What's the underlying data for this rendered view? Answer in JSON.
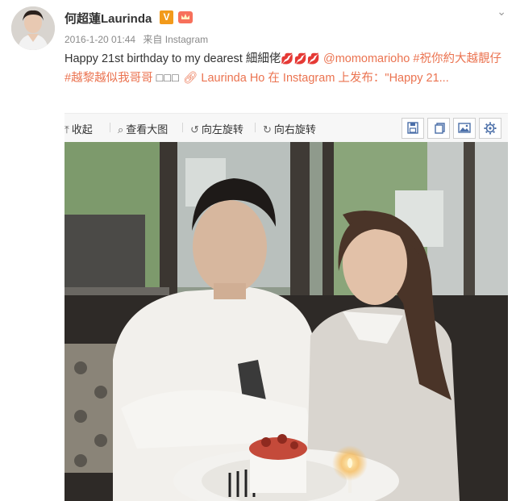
{
  "post": {
    "username": "何超蓮Laurinda",
    "verified_badge": "V",
    "meta": {
      "date": "2016-1-20 01:44",
      "source": "来自 Instagram"
    },
    "content": {
      "text_part1": "Happy 21st birthday to my dearest 細細佬",
      "emoji_glyphs": "💋💋💋",
      "mention": "@momomarioho",
      "hashtag1": "#祝你約大越靚仔",
      "hashtag2": "#越黎越似我哥哥",
      "squares": "□□□",
      "link_text": "Laurinda Ho 在 Instagram 上发布：\"Happy 21..."
    }
  },
  "toolbar": {
    "collapse_label": "收起",
    "view_large_label": "查看大图",
    "rotate_left_label": "向左旋转",
    "rotate_right_label": "向右旋转",
    "icons": [
      "save-icon",
      "copy-icon",
      "image-icon",
      "settings-icon"
    ]
  },
  "colors": {
    "link": "#eb7350",
    "badge": "#f29a1b",
    "toolbar_bg": "#f7f7f7"
  }
}
